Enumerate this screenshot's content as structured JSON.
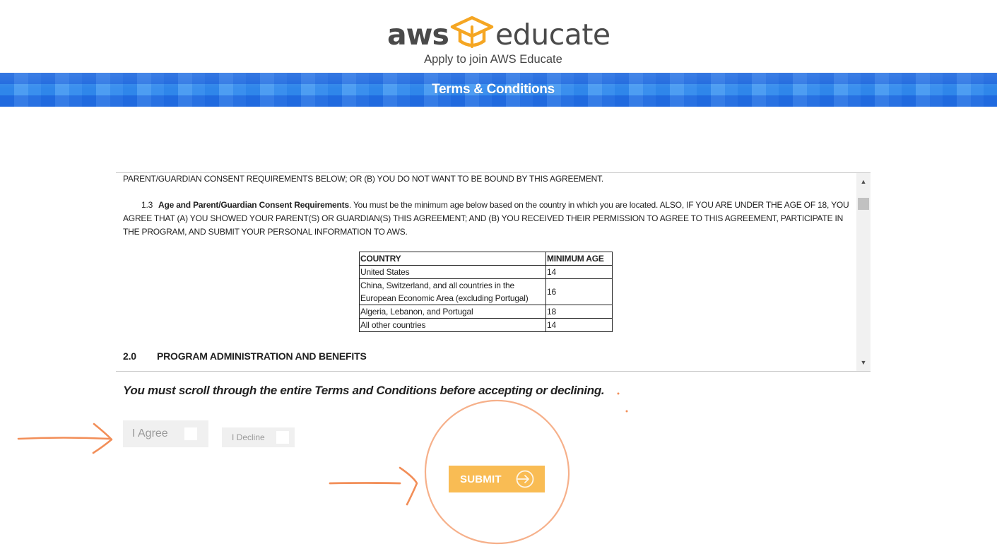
{
  "header": {
    "logo_left": "aws",
    "logo_right": "educate",
    "subtitle": "Apply to join AWS Educate"
  },
  "banner": {
    "title": "Terms & Conditions"
  },
  "terms": {
    "top_line": "PARENT/GUARDIAN CONSENT REQUIREMENTS BELOW; OR (B) YOU DO NOT WANT TO BE  BOUND BY THIS AGREEMENT.",
    "section_1_3": {
      "number": "1.3",
      "heading": "Age and Parent/Guardian Consent Requirements",
      "body": ". You must be the minimum age below based on the country in which you are located.  ALSO, IF YOU ARE UNDER THE AGE OF 18, YOU AGREE THAT (A) YOU SHOWED YOUR PARENT(S) OR GUARDIAN(S) THIS AGREEMENT; AND (B) YOU RECEIVED THEIR PERMISSION TO AGREE TO THIS AGREEMENT, PARTICIPATE IN THE PROGRAM, AND SUBMIT YOUR PERSONAL INFORMATION TO AWS."
    },
    "age_table": {
      "headers": [
        "COUNTRY",
        "MINIMUM AGE"
      ],
      "rows": [
        [
          "United States",
          "14"
        ],
        [
          "China, Switzerland, and all countries in the European Economic Area (excluding Portugal)",
          "16"
        ],
        [
          "Algeria, Lebanon, and Portugal",
          "18"
        ],
        [
          "All other countries",
          "14"
        ]
      ]
    },
    "section_2_0": {
      "number": "2.0",
      "title": "PROGRAM ADMINISTRATION AND BENEFITS"
    }
  },
  "notice": "You must scroll through the entire Terms and Conditions before accepting or declining.",
  "controls": {
    "agree_label": "I Agree",
    "agree_checked": false,
    "decline_label": "I Decline",
    "decline_checked": false,
    "submit_label": "SUBMIT",
    "submit_icon": "arrow-circle-icon"
  },
  "colors": {
    "banner_blue": "#3a8fee",
    "logo_orange": "#f5a623",
    "submit_orange": "#f9bc54",
    "annotation_orange": "#f07a3a"
  }
}
